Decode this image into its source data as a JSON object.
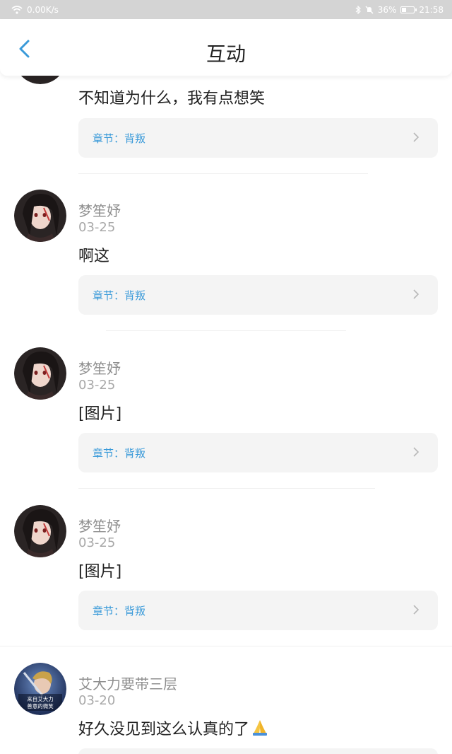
{
  "status": {
    "speed": "0.00K/s",
    "battery": "36%",
    "time": "21:58",
    "battery_level": 0.36
  },
  "header": {
    "title": "互动"
  },
  "chapter_label": "章节：背叛",
  "colors": {
    "accent": "#3a9ad9",
    "card": "#f4f4f4"
  },
  "comments": [
    {
      "text": "不知道为什么，我有点想笑",
      "chapter": "章节：背叛"
    },
    {
      "user": "梦笙妤",
      "date": "03-25",
      "text": "啊这",
      "chapter": "章节：背叛"
    },
    {
      "user": "梦笙妤",
      "date": "03-25",
      "text": "[图片]",
      "chapter": "章节：背叛"
    },
    {
      "user": "梦笙妤",
      "date": "03-25",
      "text": "[图片]",
      "chapter": "章节：背叛"
    },
    {
      "user": "艾大力要带三层",
      "date": "03-20",
      "text": "好久没见到这么认真的了",
      "emoji": "folded-hands-icon",
      "avatar_text": "来自艾大力善意的微笑"
    }
  ]
}
